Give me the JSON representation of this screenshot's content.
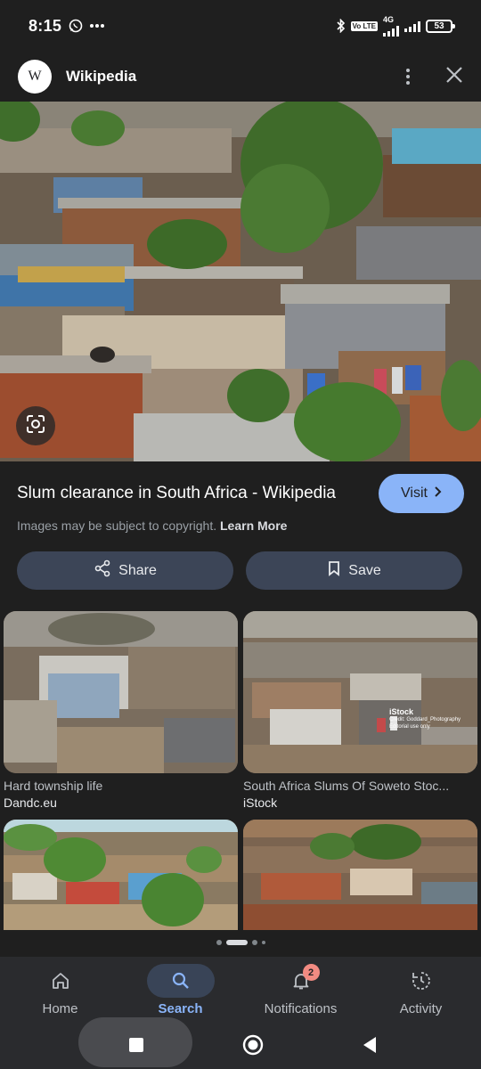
{
  "status_bar": {
    "time": "8:15",
    "battery": "53",
    "net_label": "4G",
    "volte_label": "Vo LTE",
    "icons": [
      "whatsapp-icon",
      "more-notifications-icon",
      "bluetooth-icon",
      "volte-icon",
      "signal-icon",
      "battery-icon"
    ]
  },
  "header": {
    "logo_letter": "W",
    "site_name": "Wikipedia"
  },
  "result": {
    "title": "Slum clearance in South Africa - Wikipedia",
    "visit_label": "Visit",
    "copyright_text": "Images may be subject to copyright.",
    "learn_more": "Learn More",
    "share_label": "Share",
    "save_label": "Save"
  },
  "related": [
    {
      "title": "Hard township life",
      "source": "Dandc.eu"
    },
    {
      "title": "South Africa Slums Of Soweto Stoc...",
      "source": "iStock"
    },
    {
      "title": "",
      "source": ""
    },
    {
      "title": "",
      "source": ""
    }
  ],
  "watermark": {
    "brand": "iStock",
    "credit": "Credit: Goddard_Photography",
    "note": "Editorial use only"
  },
  "bottom_nav": {
    "items": [
      {
        "label": "Home",
        "icon": "home-icon"
      },
      {
        "label": "Search",
        "icon": "search-icon",
        "active": true
      },
      {
        "label": "Notifications",
        "icon": "bell-icon",
        "badge": "2"
      },
      {
        "label": "Activity",
        "icon": "history-icon"
      }
    ]
  },
  "colors": {
    "background": "#1f1f1f",
    "accent": "#8ab4f8",
    "button_bg": "#3c4557",
    "badge": "#f28b82"
  }
}
